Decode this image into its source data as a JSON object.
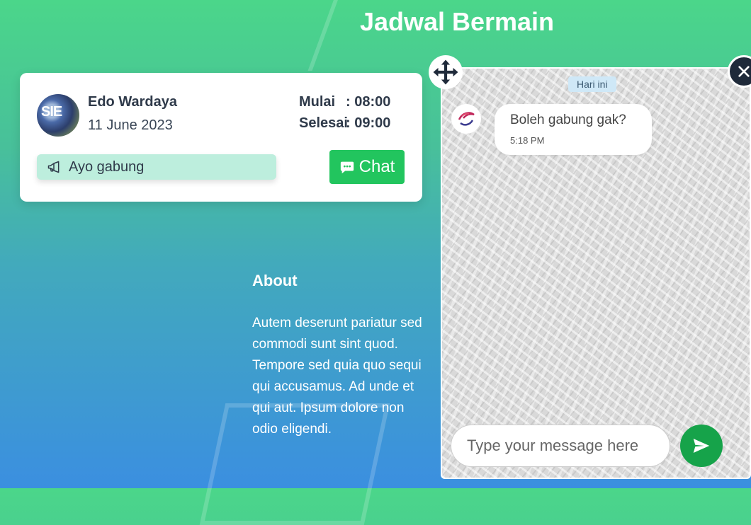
{
  "page": {
    "title": "Jadwal Bermain"
  },
  "card": {
    "name": "Edo Wardaya",
    "date": "11 June 2023",
    "avatar_text": "SIE",
    "start_label": "Mulai",
    "start_value": ": 08:00",
    "end_label": "Selesai",
    "end_value": ": 09:00",
    "tag_label": "Ayo gabung",
    "tag_icon": "megaphone-icon",
    "chat_label": "Chat",
    "chat_icon": "chat-bubble-icon"
  },
  "about": {
    "title": "About",
    "text": "Autem deserunt pariatur sed commodi sunt sint quod. Tempore sed quia quo sequi qui accusamus. Ad unde et qui aut. Ipsum dolore non odio eligendi."
  },
  "chat": {
    "date_chip": "Hari ini",
    "messages": [
      {
        "text": "Boleh gabung gak?",
        "time": "5:18 PM"
      }
    ],
    "input_placeholder": "Type your message here",
    "send_icon": "send-icon",
    "move_icon": "move-icon",
    "close_icon": "close-icon"
  },
  "colors": {
    "accent": "#22c55e",
    "send": "#16a34a",
    "tag_bg": "#bdeedd",
    "close_bg": "#1f2a3a"
  }
}
